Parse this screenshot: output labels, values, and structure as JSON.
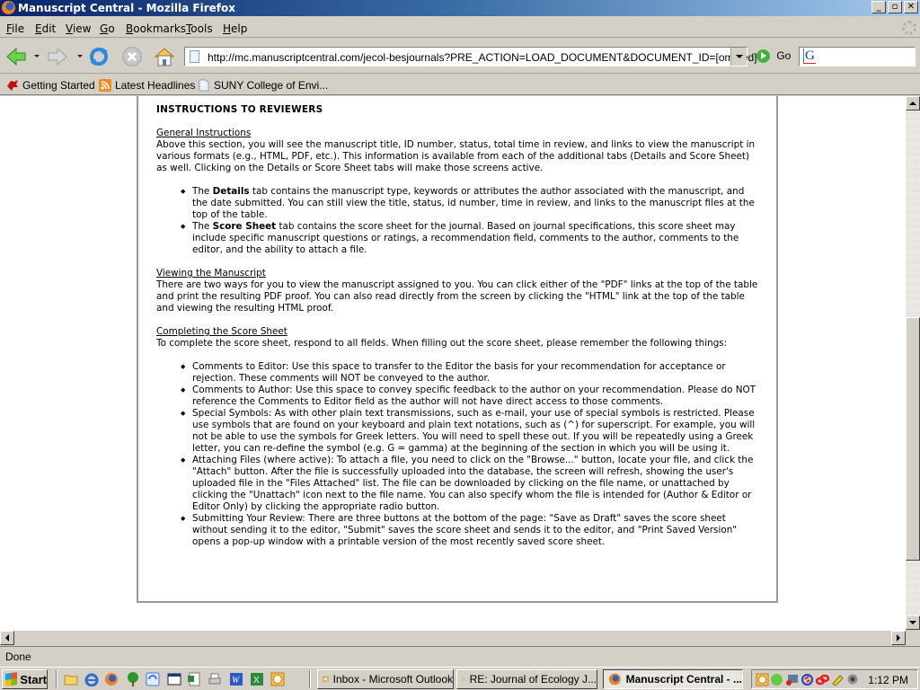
{
  "window": {
    "title": "Manuscript Central - Mozilla Firefox",
    "controls": [
      "minimize",
      "restore",
      "close"
    ]
  },
  "menu": [
    "File",
    "Edit",
    "View",
    "Go",
    "Bookmarks",
    "Tools",
    "Help"
  ],
  "navigation": {
    "back_icon": "back-arrow-icon",
    "forward_icon": "forward-arrow-icon",
    "reload_icon": "reload-icon",
    "stop_icon": "stop-icon",
    "home_icon": "home-icon",
    "url": "http://mc.manuscriptcentral.com/jecol-besjournals?PRE_ACTION=LOAD_DOCUMENT&DOCUMENT_ID=[omitted]",
    "go_label": "Go",
    "search_value": ""
  },
  "bookmarks": [
    {
      "label": "Getting Started",
      "icon": "firefox-dino-icon"
    },
    {
      "label": "Latest Headlines",
      "icon": "rss-icon"
    },
    {
      "label": "SUNY College of Envi...",
      "icon": "page-icon"
    }
  ],
  "document": {
    "heading": "INSTRUCTIONS TO REVIEWERS",
    "sections": [
      {
        "title": "General Instructions",
        "body": "Above this section, you will see the manuscript title, ID number, status, total time in review, and links to view the manuscript in various formats (e.g., HTML, PDF, etc.). This information is available from each of the additional tabs (Details and Score Sheet) as well. Clicking on the Details or Score Sheet tabs will make those screens active.",
        "bullets": [
          {
            "pre": "The ",
            "bold": "Details",
            "post": " tab contains the manuscript type, keywords or attributes the author associated with the manuscript, and the date submitted. You can still view the title, status, id number, time in review, and links to the manuscript files at the top of the table."
          },
          {
            "pre": "The ",
            "bold": "Score Sheet",
            "post": " tab contains the score sheet for the journal. Based on journal specifications, this score sheet may include specific manuscript questions or ratings, a recommendation field, comments to the author, comments to the editor, and the ability to attach a file."
          }
        ]
      },
      {
        "title": "Viewing the Manuscript",
        "body": "There are two ways for you to view the manuscript assigned to you. You can click either of the \"PDF\" links at the top of the table and print the resulting PDF proof. You can also read directly from the screen by clicking the \"HTML\" link at the top of the table and viewing the resulting HTML proof."
      },
      {
        "title": "Completing the Score Sheet",
        "body": "To complete the score sheet, respond to all fields. When filling out the score sheet, please remember the following things:",
        "bullets": [
          "Comments to Editor: Use this space to transfer to the Editor the basis for your recommendation for acceptance or rejection. These comments will NOT be conveyed to the author.",
          "Comments to Author: Use this space to convey specific feedback to the author on your recommendation. Please do NOT reference the Comments to Editor field as the author will not have direct access to those comments.",
          "Special Symbols: As with other plain text transmissions, such as e-mail, your use of special symbols is restricted. Please use symbols that are found on your keyboard and plain text notations, such as (^) for superscript. For example, you will not be able to use the symbols for Greek letters. You will need to spell these out. If you will be repeatedly using a Greek letter, you can re-define the symbol (e.g. G = gamma) at the beginning of the section in which you will be using it.",
          "Attaching Files (where active): To attach a file, you need to click on the \"Browse...\" button, locate your file, and click the \"Attach\" button. After the file is successfully uploaded into the database, the screen will refresh, showing the user's uploaded file in the \"Files Attached\" list. The file can be downloaded by clicking on the file name, or unattached by clicking the \"Unattach\" icon next to the file name. You can also specify whom the file is intended for (Author & Editor or Editor Only) by clicking the appropriate radio button.",
          "Submitting Your Review: There are three buttons at the bottom of the page: \"Save as Draft\" saves the score sheet without sending it to the editor, \"Submit\" saves the score sheet and sends it to the editor, and \"Print Saved Version\" opens a pop-up window with a printable version of the most recently saved score sheet."
        ]
      }
    ]
  },
  "scroll": {
    "vertical_position_fraction": 0.45
  },
  "status": "Done",
  "taskbar": {
    "start_label": "Start",
    "quicklaunch": [
      "folder-icon",
      "internet-explorer-icon",
      "firefox-icon",
      "tree-icon",
      "sync-icon",
      "window-icon",
      "spreadsheet-doc-icon",
      "printer-icon",
      "word-icon",
      "excel-icon",
      "outlook-clock-icon"
    ],
    "tasks": [
      {
        "label": "Inbox - Microsoft Outlook",
        "icon": "outlook-icon",
        "active": false
      },
      {
        "label": "RE: Journal of Ecology J...",
        "icon": "envelope-icon",
        "active": false
      },
      {
        "label": "Manuscript Central - ...",
        "icon": "firefox-icon",
        "active": true
      }
    ],
    "tray_icons": [
      "reminder-icon",
      "messenger-icon",
      "camera-icon",
      "update-icon",
      "link-icon",
      "pencil-icon",
      "speaker-icon"
    ],
    "clock": "1:12 PM"
  },
  "colors": {
    "titlebar_start": "#0a246a",
    "titlebar_end": "#a6caf0",
    "chrome": "#d4d0c8",
    "panel_border": "#999999"
  }
}
